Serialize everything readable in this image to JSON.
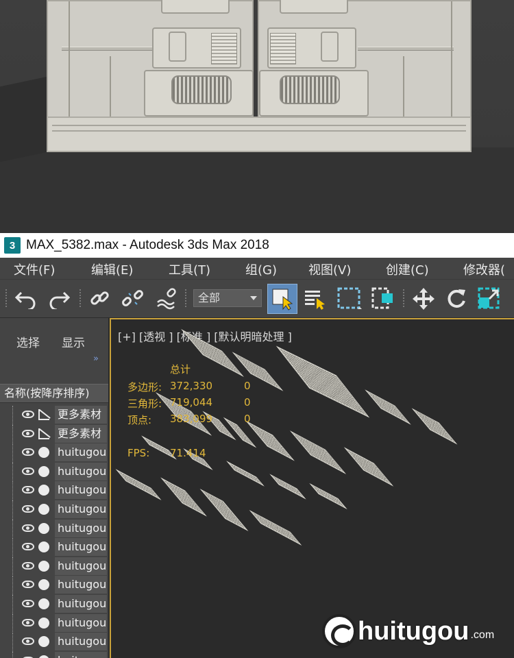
{
  "window": {
    "app_icon_label": "3",
    "title": "MAX_5382.max - Autodesk 3ds Max 2018"
  },
  "menu": [
    {
      "label": "文件(F)"
    },
    {
      "label": "编辑(E)"
    },
    {
      "label": "工具(T)"
    },
    {
      "label": "组(G)"
    },
    {
      "label": "视图(V)"
    },
    {
      "label": "创建(C)"
    },
    {
      "label": "修改器("
    }
  ],
  "toolbar": {
    "selection_filter": "全部",
    "icons": [
      "undo-icon",
      "redo-icon",
      "link-icon",
      "unlink-icon",
      "bind-space-warp-icon",
      "select-object-icon",
      "select-by-name-icon",
      "rectangular-selection-icon",
      "window-crossing-icon",
      "move-icon",
      "rotate-icon",
      "scale-icon"
    ]
  },
  "explorer": {
    "tabs": [
      "选择",
      "显示"
    ],
    "more": "»",
    "column_header": "名称(按降序排序)",
    "rows": [
      {
        "type": "shape",
        "name": "更多素材"
      },
      {
        "type": "shape",
        "name": "更多素材"
      },
      {
        "type": "sphere",
        "name": "huitugou"
      },
      {
        "type": "sphere",
        "name": "huitugou"
      },
      {
        "type": "sphere",
        "name": "huitugou"
      },
      {
        "type": "sphere",
        "name": "huitugou"
      },
      {
        "type": "sphere",
        "name": "huitugou"
      },
      {
        "type": "sphere",
        "name": "huitugou"
      },
      {
        "type": "sphere",
        "name": "huitugou"
      },
      {
        "type": "sphere",
        "name": "huitugou"
      },
      {
        "type": "sphere",
        "name": "huitugou"
      },
      {
        "type": "sphere",
        "name": "huitugou"
      },
      {
        "type": "sphere",
        "name": "huitugou"
      },
      {
        "type": "sphere",
        "name": "huitu"
      }
    ]
  },
  "viewport": {
    "label": "[+] [透视 ] [标准 ] [默认明暗处理 ]",
    "stats": {
      "total_label": "总计",
      "polys_label": "多边形:",
      "polys_value": "372,330",
      "polys_sel": "0",
      "tris_label": "三角形:",
      "tris_value": "719,044",
      "tris_sel": "0",
      "verts_label": "顶点:",
      "verts_value": "383,099",
      "verts_sel": "0",
      "fps_label": "FPS:",
      "fps_value": "71.414"
    },
    "accent_color": "#c9a23a",
    "stats_color": "#e2b83a"
  },
  "watermark": {
    "text": "huitugou",
    "suffix": ".com"
  }
}
